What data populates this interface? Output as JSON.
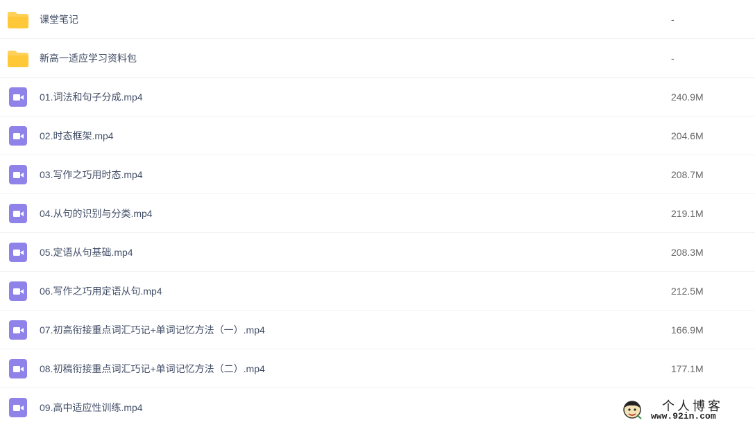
{
  "files": [
    {
      "name": "课堂笔记",
      "size": "-",
      "type": "folder"
    },
    {
      "name": "新高一适应学习资料包",
      "size": "-",
      "type": "folder"
    },
    {
      "name": "01.词法和句子分成.mp4",
      "size": "240.9M",
      "type": "video"
    },
    {
      "name": "02.时态框架.mp4",
      "size": "204.6M",
      "type": "video"
    },
    {
      "name": "03.写作之巧用时态.mp4",
      "size": "208.7M",
      "type": "video"
    },
    {
      "name": "04.从句的识别与分类.mp4",
      "size": "219.1M",
      "type": "video"
    },
    {
      "name": "05.定语从句基础.mp4",
      "size": "208.3M",
      "type": "video"
    },
    {
      "name": "06.写作之巧用定语从句.mp4",
      "size": "212.5M",
      "type": "video"
    },
    {
      "name": "07.初高衔接重点词汇巧记+单词记忆方法（一）.mp4",
      "size": "166.9M",
      "type": "video"
    },
    {
      "name": "08.初稿衔接重点词汇巧记+单词记忆方法（二）.mp4",
      "size": "177.1M",
      "type": "video"
    },
    {
      "name": "09.高中适应性训练.mp4",
      "size": "",
      "type": "video"
    }
  ],
  "icons": {
    "folder": "folder-icon",
    "video": "video-file-icon"
  },
  "colors": {
    "folder": "#ffd159",
    "video": "#8f82e8",
    "divider": "#f1f2f4",
    "name_text": "#424e67",
    "size_text": "#666666"
  },
  "watermark": {
    "title": "个人博客",
    "url": "www.92in.com"
  }
}
